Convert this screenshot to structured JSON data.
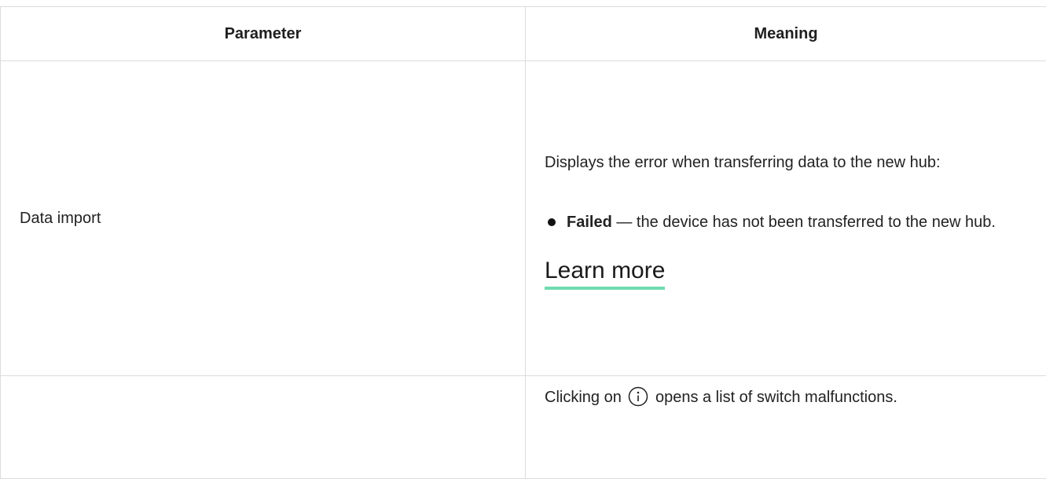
{
  "table": {
    "headers": {
      "parameter": "Parameter",
      "meaning": "Meaning"
    },
    "rows": [
      {
        "parameter": "Data import",
        "description": "Displays the error when transferring data to the new hub:",
        "bullet": {
          "label": "Failed",
          "text": " — the device has not been transferred to the new hub."
        },
        "link": "Learn more"
      },
      {
        "parameter": "",
        "text_before_icon": "Clicking on",
        "icon": "info-icon",
        "text_after_icon": " opens a list of switch malfunctions."
      }
    ]
  },
  "colors": {
    "link_underline": "#6fdcb0",
    "border": "#dcdcdc",
    "text": "#222222"
  }
}
